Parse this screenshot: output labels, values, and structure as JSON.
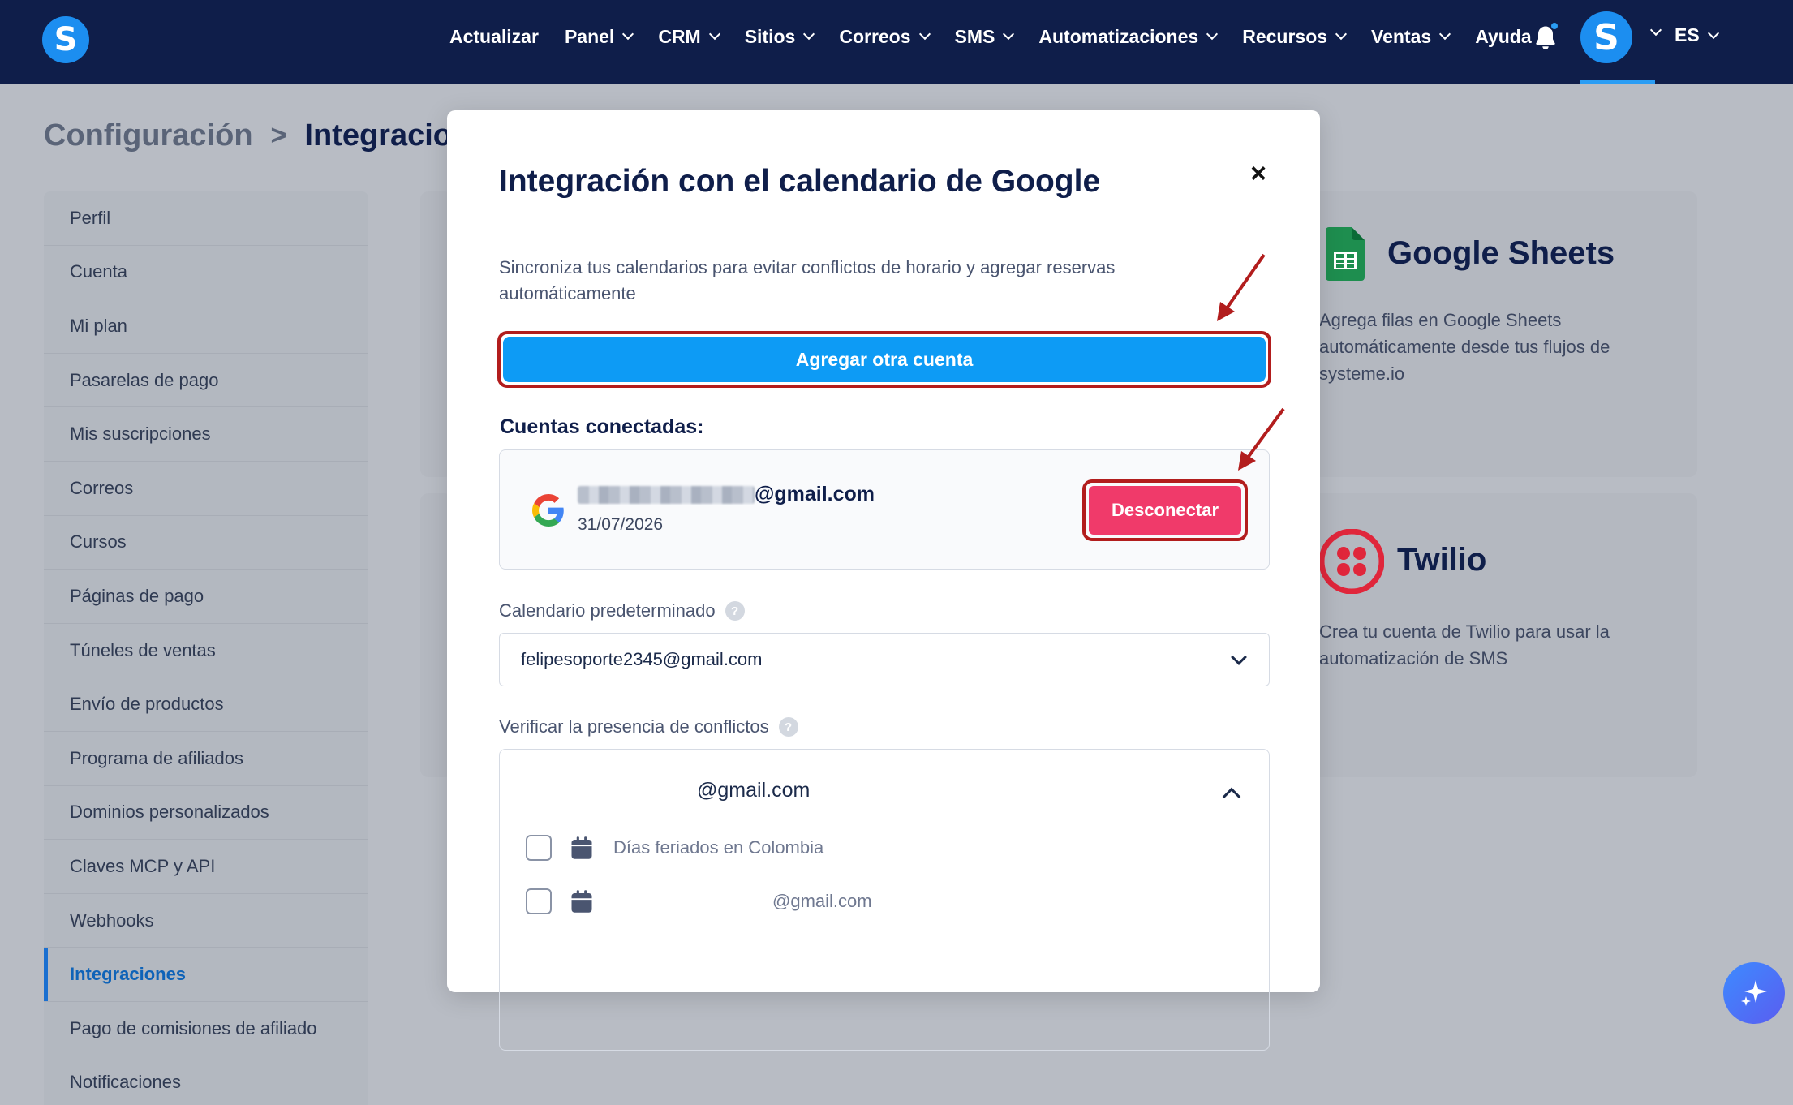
{
  "nav": {
    "items": [
      {
        "label": "Actualizar",
        "dropdown": false
      },
      {
        "label": "Panel",
        "dropdown": true
      },
      {
        "label": "CRM",
        "dropdown": true
      },
      {
        "label": "Sitios",
        "dropdown": true
      },
      {
        "label": "Correos",
        "dropdown": true
      },
      {
        "label": "SMS",
        "dropdown": true
      },
      {
        "label": "Automatizaciones",
        "dropdown": true
      },
      {
        "label": "Recursos",
        "dropdown": true
      },
      {
        "label": "Ventas",
        "dropdown": true
      },
      {
        "label": "Ayuda",
        "dropdown": false
      }
    ],
    "logo_letter": "S",
    "avatar_letter": "S",
    "language": "ES",
    "icons": {
      "bell": "bell-icon",
      "chevron": "chevron-down-icon"
    }
  },
  "breadcrumb": {
    "parent": "Configuración",
    "separator": ">",
    "current": "Integraciones"
  },
  "sidebar": {
    "items": [
      {
        "label": "Perfil",
        "active": false
      },
      {
        "label": "Cuenta",
        "active": false
      },
      {
        "label": "Mi plan",
        "active": false
      },
      {
        "label": "Pasarelas de pago",
        "active": false
      },
      {
        "label": "Mis suscripciones",
        "active": false
      },
      {
        "label": "Correos",
        "active": false
      },
      {
        "label": "Cursos",
        "active": false
      },
      {
        "label": "Páginas de pago",
        "active": false
      },
      {
        "label": "Túneles de ventas",
        "active": false
      },
      {
        "label": "Envío de productos",
        "active": false
      },
      {
        "label": "Programa de afiliados",
        "active": false
      },
      {
        "label": "Dominios personalizados",
        "active": false
      },
      {
        "label": "Claves MCP y API",
        "active": false
      },
      {
        "label": "Webhooks",
        "active": false
      },
      {
        "label": "Integraciones",
        "active": true
      },
      {
        "label": "Pago de comisiones de afiliado",
        "active": false
      },
      {
        "label": "Notificaciones",
        "active": false
      }
    ]
  },
  "cards": {
    "sheets": {
      "title": "Google Sheets",
      "description": "Agrega filas en Google Sheets automáticamente desde tus flujos de systeme.io"
    },
    "twilio": {
      "title": "Twilio",
      "description": "Crea tu cuenta de Twilio para usar la automatización de SMS"
    }
  },
  "modal": {
    "title": "Integración con el calendario de Google",
    "close": "×",
    "description": "Sincroniza tus calendarios para evitar conflictos de horario y agregar reservas automáticamente",
    "add_account_label": "Agregar otra cuenta",
    "connected_label": "Cuentas conectadas:",
    "account": {
      "email_suffix": "@gmail.com",
      "date": "31/07/2026",
      "disconnect_label": "Desconectar"
    },
    "default_calendar": {
      "label": "Calendario predeterminado",
      "help": "?",
      "value": "felipesoporte2345@gmail.com"
    },
    "conflicts": {
      "label": "Verificar la presencia de conflictos",
      "help": "?",
      "group_title": "@gmail.com",
      "calendars": [
        {
          "name": "Días feriados en Colombia",
          "checked": false
        },
        {
          "name": "@gmail.com",
          "checked": false
        }
      ]
    }
  },
  "colors": {
    "nav_bg": "#0f1e4a",
    "primary": "#0d9bf5",
    "danger": "#f03a6a",
    "annotation": "#b21d1d"
  }
}
